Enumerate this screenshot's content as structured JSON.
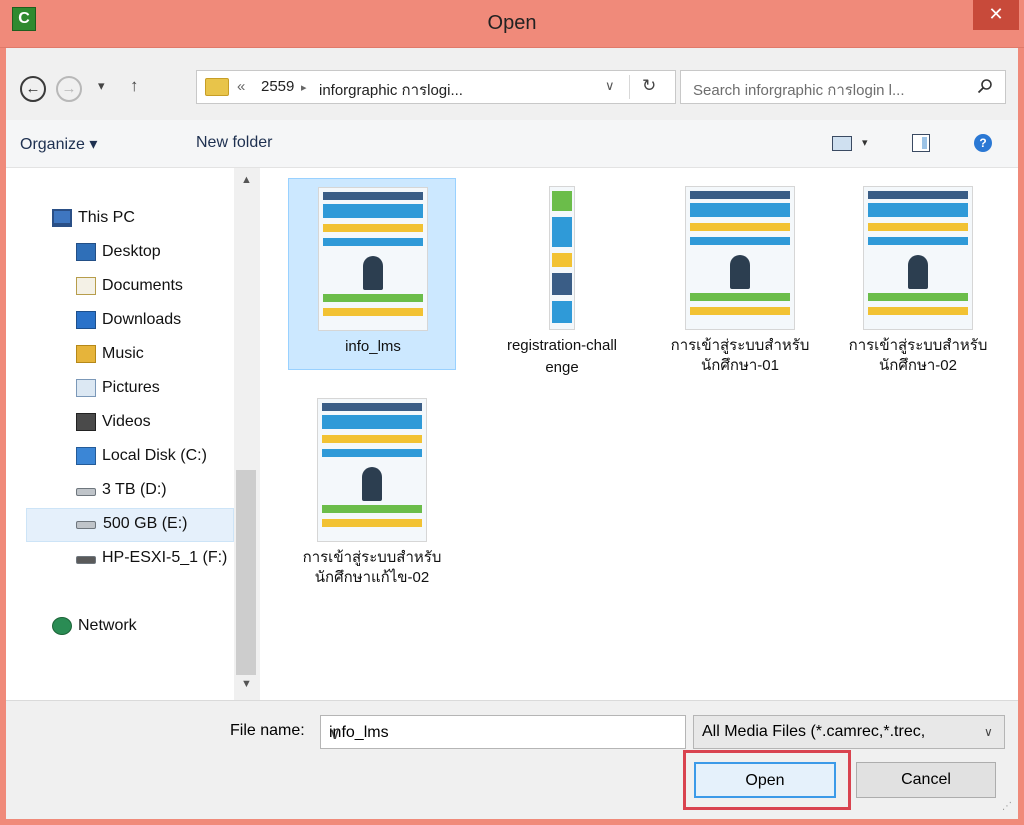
{
  "window": {
    "title": "Open",
    "app_icon_letter": "C",
    "close_glyph": "✕",
    "accent_color": "#f08a7a"
  },
  "nav": {
    "back_glyph": "←",
    "forward_glyph": "→",
    "recent_glyph": "▾",
    "up_glyph": "↑",
    "breadcrumb": [
      "«",
      "2559",
      "▸",
      "inforgraphic การlogi..."
    ],
    "address_dropdown_glyph": "∨",
    "refresh_glyph": "↻",
    "search_placeholder": "Search inforgraphic การlogin l..."
  },
  "toolbar": {
    "organize_label": "Organize ▾",
    "new_folder_label": "New folder",
    "help_glyph": "?",
    "view_caret": "▾"
  },
  "sidebar": {
    "items": [
      {
        "label": "This PC",
        "icon": "computer-icon"
      },
      {
        "label": "Desktop",
        "icon": "desktop-icon"
      },
      {
        "label": "Documents",
        "icon": "documents-icon"
      },
      {
        "label": "Downloads",
        "icon": "downloads-icon"
      },
      {
        "label": "Music",
        "icon": "music-icon"
      },
      {
        "label": "Pictures",
        "icon": "pictures-icon"
      },
      {
        "label": "Videos",
        "icon": "videos-icon"
      },
      {
        "label": "Local Disk (C:)",
        "icon": "windows-drive-icon"
      },
      {
        "label": "3 TB (D:)",
        "icon": "drive-icon"
      },
      {
        "label": "500 GB (E:)",
        "icon": "drive-icon",
        "selected": true
      },
      {
        "label": "HP-ESXI-5_1 (F:)",
        "icon": "network-drive-icon"
      },
      {
        "label": "Network",
        "icon": "network-icon"
      }
    ],
    "scroll_up_glyph": "▲",
    "scroll_down_glyph": "▼"
  },
  "files": [
    {
      "name": "info_lms",
      "selected": true
    },
    {
      "name_line1": "registration-chall",
      "name_line2": "enge"
    },
    {
      "name_line1": "การเข้าสู่ระบบสำหรับ",
      "name_line2": "นักศึกษา-01"
    },
    {
      "name_line1": "การเข้าสู่ระบบสำหรับ",
      "name_line2": "นักศึกษา-02"
    },
    {
      "name_line1": "การเข้าสู่ระบบสำหรับ",
      "name_line2": "นักศึกษาแก้ไข-02"
    }
  ],
  "footer": {
    "file_name_label": "File name:",
    "file_name_value": "info_lms",
    "filter_value": "All Media Files (*.camrec,*.trec,",
    "dropdown_glyph": "∨",
    "open_label": "Open",
    "cancel_label": "Cancel",
    "grip_glyph": "⋰"
  }
}
